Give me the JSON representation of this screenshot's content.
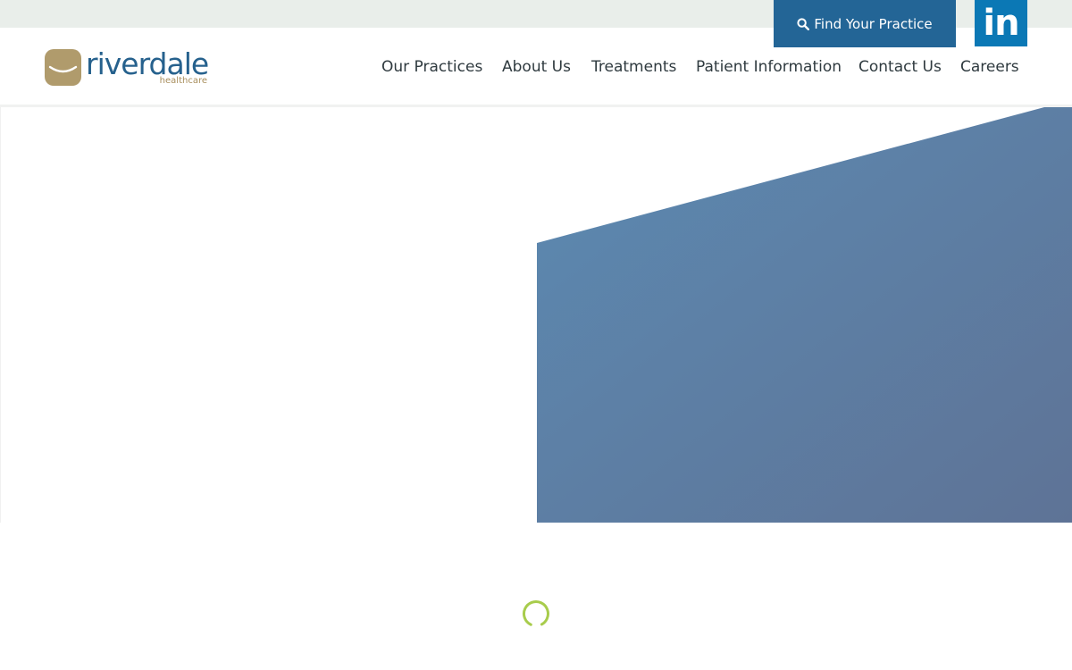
{
  "top_bar": {
    "find_practice_label": "Find Your Practice",
    "find_practice_icon": "search-icon",
    "social_icon": "linkedin-icon",
    "social_label": "in"
  },
  "logo": {
    "word": "riverdale",
    "sub": "healthcare",
    "mark_icon": "smile-mark-icon"
  },
  "nav": {
    "items": [
      {
        "label": "Our Practices"
      },
      {
        "label": "About Us"
      },
      {
        "label": "Treatments"
      },
      {
        "label": "Patient Information"
      },
      {
        "label": "Contact Us"
      },
      {
        "label": "Careers"
      }
    ]
  },
  "hero": {
    "panel_icon": "hero-angled-panel"
  },
  "loading": {
    "icon": "loading-spinner-icon"
  },
  "colors": {
    "top_bar_bg": "#e9eeea",
    "brand_blue": "#236596",
    "linkedin_blue": "#0b78b5",
    "logo_gold": "#b09b6c",
    "hero_blue_start": "#5c8ab2",
    "hero_blue_end": "#5e7396",
    "spinner_green": "#a8cc4c"
  }
}
